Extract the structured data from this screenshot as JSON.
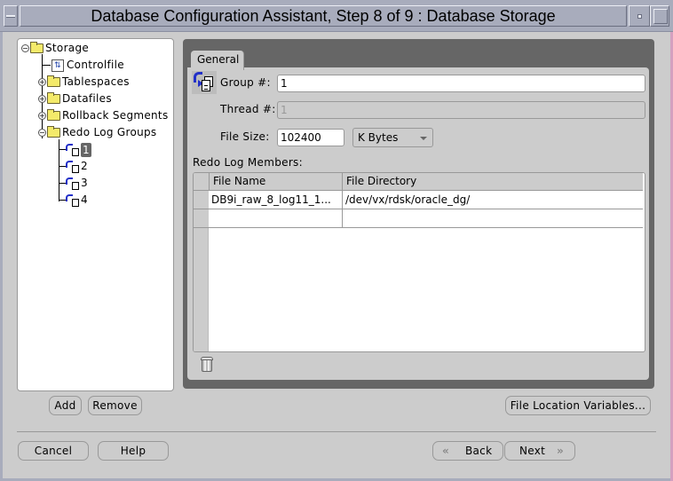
{
  "window": {
    "title": "Database Configuration Assistant, Step 8 of 9 : Database Storage",
    "controls": [
      "window-menu",
      "minimize",
      "maximize"
    ]
  },
  "tree": {
    "items": [
      {
        "label": "Storage",
        "icon": "folder-icon",
        "expander": "collapse",
        "level": 0
      },
      {
        "label": "Controlfile",
        "icon": "controlfile-icon",
        "expander": null,
        "level": 1
      },
      {
        "label": "Tablespaces",
        "icon": "folder-icon",
        "expander": "expand",
        "level": 1
      },
      {
        "label": "Datafiles",
        "icon": "folder-icon",
        "expander": "expand",
        "level": 1
      },
      {
        "label": "Rollback Segments",
        "icon": "folder-icon",
        "expander": "expand",
        "level": 1
      },
      {
        "label": "Redo Log Groups",
        "icon": "folder-icon",
        "expander": "collapse",
        "level": 1
      },
      {
        "label": "1",
        "icon": "redo-log-group-icon",
        "expander": null,
        "level": 2,
        "selected": true
      },
      {
        "label": "2",
        "icon": "redo-log-group-icon",
        "expander": null,
        "level": 2
      },
      {
        "label": "3",
        "icon": "redo-log-group-icon",
        "expander": null,
        "level": 2
      },
      {
        "label": "4",
        "icon": "redo-log-group-icon",
        "expander": null,
        "level": 2
      }
    ],
    "add_label": "Add",
    "remove_label": "Remove"
  },
  "panel": {
    "tab_label": "General",
    "group_label": "Group #:",
    "group_value": "1",
    "thread_label": "Thread #:",
    "thread_value": "1",
    "filesize_label": "File Size:",
    "filesize_value": "102400",
    "filesize_unit": "K Bytes",
    "members_label": "Redo Log Members:",
    "table": {
      "columns": [
        "File Name",
        "File Directory"
      ],
      "rows": [
        [
          "DB9i_raw_8_log11_1...",
          "/dev/vx/rdsk/oracle_dg/"
        ],
        [
          "",
          ""
        ]
      ]
    },
    "file_location_label": "File Location Variables..."
  },
  "footer": {
    "cancel_label": "Cancel",
    "help_label": "Help",
    "back_label": "Back",
    "next_label": "Next"
  }
}
